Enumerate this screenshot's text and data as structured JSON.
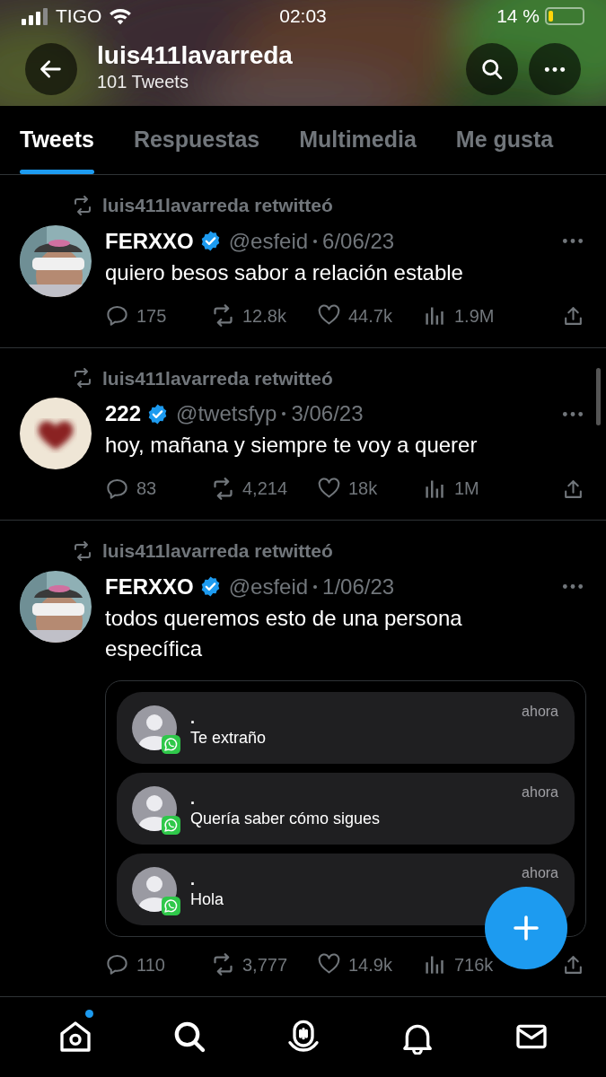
{
  "status_bar": {
    "carrier": "TIGO",
    "time": "02:03",
    "battery": "14 %"
  },
  "header": {
    "title": "luis411lavarreda",
    "subtitle": "101 Tweets"
  },
  "tabs": [
    {
      "label": "Tweets",
      "selected": true
    },
    {
      "label": "Respuestas",
      "selected": false
    },
    {
      "label": "Multimedia",
      "selected": false
    },
    {
      "label": "Me gusta",
      "selected": false
    }
  ],
  "tweets": [
    {
      "retweeted_by": "luis411lavarreda retwitteó",
      "name": "FERXXO",
      "verified": true,
      "handle": "@esfeid",
      "date": "6/06/23",
      "text": "quiero besos sabor a relación estable",
      "stats": {
        "replies": "175",
        "retweets": "12.8k",
        "likes": "44.7k",
        "views": "1.9M"
      }
    },
    {
      "retweeted_by": "luis411lavarreda retwitteó",
      "name": "222",
      "verified": true,
      "handle": "@twetsfyp",
      "date": "3/06/23",
      "text": "hoy, mañana y siempre te voy a querer",
      "stats": {
        "replies": "83",
        "retweets": "4,214",
        "likes": "18k",
        "views": "1M"
      }
    },
    {
      "retweeted_by": "luis411lavarreda retwitteó",
      "name": "FERXXO",
      "verified": true,
      "handle": "@esfeid",
      "date": "1/06/23",
      "text": "todos queremos esto de una persona específica",
      "media": {
        "kind": "notifications",
        "items": [
          {
            "sender": ".",
            "message": "Te extraño",
            "time": "ahora"
          },
          {
            "sender": ".",
            "message": "Quería saber cómo sigues",
            "time": "ahora"
          },
          {
            "sender": ".",
            "message": "Hola",
            "time": "ahora"
          }
        ]
      },
      "stats": {
        "replies": "110",
        "retweets": "3,777",
        "likes": "14.9k",
        "views": "716k"
      }
    }
  ],
  "bottom_nav": [
    {
      "kind": "home",
      "badge": true
    },
    {
      "kind": "search",
      "badge": false
    },
    {
      "kind": "spaces",
      "badge": false
    },
    {
      "kind": "notifications",
      "badge": false
    },
    {
      "kind": "messages",
      "badge": false
    }
  ]
}
